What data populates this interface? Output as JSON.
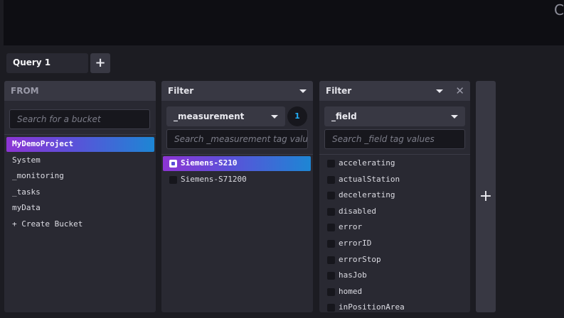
{
  "editor": {
    "glyph": "C"
  },
  "query": {
    "tab_label": "Query 1",
    "add_label": "+"
  },
  "from": {
    "header": "FROM",
    "search_placeholder": "Search for a bucket",
    "buckets": [
      "MyDemoProject",
      "System",
      "_monitoring",
      "_tasks",
      "myData",
      "+ Create Bucket"
    ],
    "selected": "MyDemoProject"
  },
  "filter1": {
    "header": "Filter",
    "key": "_measurement",
    "count": "1",
    "search_placeholder": "Search _measurement tag values",
    "values": [
      {
        "label": "Siemens-S210",
        "checked": true
      },
      {
        "label": "Siemens-S71200",
        "checked": false
      }
    ]
  },
  "filter2": {
    "header": "Filter",
    "close": "✕",
    "key": "_field",
    "search_placeholder": "Search _field tag values",
    "values": [
      {
        "label": "accelerating",
        "checked": false
      },
      {
        "label": "actualStation",
        "checked": false
      },
      {
        "label": "decelerating",
        "checked": false
      },
      {
        "label": "disabled",
        "checked": false
      },
      {
        "label": "error",
        "checked": false
      },
      {
        "label": "errorID",
        "checked": false
      },
      {
        "label": "errorStop",
        "checked": false
      },
      {
        "label": "hasJob",
        "checked": false
      },
      {
        "label": "homed",
        "checked": false
      },
      {
        "label": "inPositionArea",
        "checked": false
      }
    ]
  },
  "add_filter": {
    "label": "+"
  },
  "colors": {
    "selection_start": "#8d35d4",
    "selection_end": "#1d86d4",
    "badge_text": "#22adf6"
  }
}
